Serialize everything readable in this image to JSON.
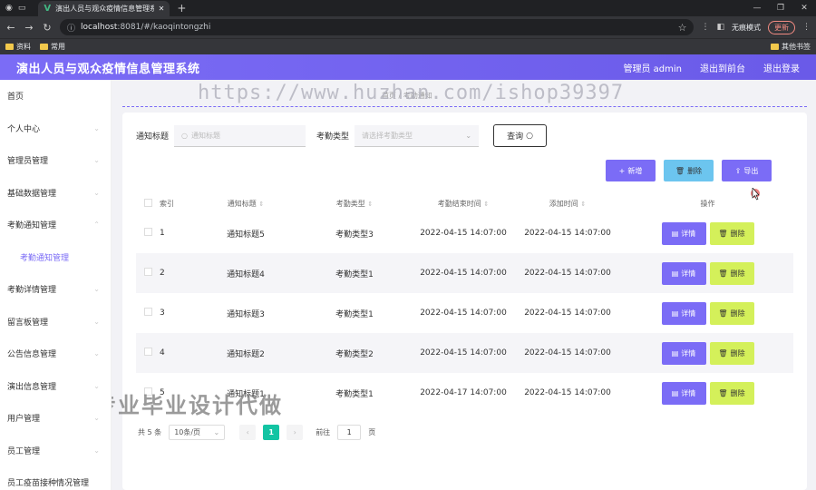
{
  "browser": {
    "tab_title": "演出人员与观众疫情信息管理系统",
    "url_host": "localhost",
    "url_rest": ":8081/#/kaoqintongzhi",
    "incognito_label": "无痕模式",
    "update_label": "更新",
    "bookmarks": [
      "资料",
      "常用"
    ],
    "bookmarks_right": "其他书签"
  },
  "header": {
    "title": "演出人员与观众疫情信息管理系统",
    "user": "管理员 admin",
    "back": "退出到前台",
    "logout": "退出登录"
  },
  "sidebar": {
    "items": [
      {
        "label": "首页"
      },
      {
        "label": "个人中心"
      },
      {
        "label": "管理员管理"
      },
      {
        "label": "基础数据管理"
      },
      {
        "label": "考勤通知管理"
      },
      {
        "label": "考勤通知管理"
      },
      {
        "label": "考勤详情管理"
      },
      {
        "label": "留言板管理"
      },
      {
        "label": "公告信息管理"
      },
      {
        "label": "演出信息管理"
      },
      {
        "label": "用户管理"
      },
      {
        "label": "员工管理"
      },
      {
        "label": "员工疫苗接种情况管理"
      }
    ]
  },
  "watermarks": {
    "url": "https://www.huzhan.com/ishop39397",
    "text": "专业毕业设计代做"
  },
  "breadcrumb": "首页 / 考勤通知",
  "search": {
    "title_label": "通知标题",
    "title_placeholder": "通知标题",
    "type_label": "考勤类型",
    "type_placeholder": "请选择考勤类型",
    "query_label": "查询"
  },
  "actions": {
    "add": "新增",
    "delete": "删除",
    "export": "导出"
  },
  "table": {
    "headers": [
      "索引",
      "通知标题",
      "考勤类型",
      "考勤结束时间",
      "添加时间",
      "操作"
    ],
    "rows": [
      {
        "idx": "1",
        "title": "通知标题5",
        "type": "考勤类型3",
        "end": "2022-04-15 14:07:00",
        "added": "2022-04-15 14:07:00"
      },
      {
        "idx": "2",
        "title": "通知标题4",
        "type": "考勤类型1",
        "end": "2022-04-15 14:07:00",
        "added": "2022-04-15 14:07:00"
      },
      {
        "idx": "3",
        "title": "通知标题3",
        "type": "考勤类型1",
        "end": "2022-04-15 14:07:00",
        "added": "2022-04-15 14:07:00"
      },
      {
        "idx": "4",
        "title": "通知标题2",
        "type": "考勤类型2",
        "end": "2022-04-15 14:07:00",
        "added": "2022-04-15 14:07:00"
      },
      {
        "idx": "5",
        "title": "通知标题1",
        "type": "考勤类型1",
        "end": "2022-04-17 14:07:00",
        "added": "2022-04-15 14:07:00"
      }
    ],
    "detail_label": "详情",
    "delete_label": "删除"
  },
  "pager": {
    "total": "共 5 条",
    "page_size": "10条/页",
    "prev": "‹",
    "current": "1",
    "next": "›",
    "goto_label": "前往",
    "goto_value": "1",
    "page_unit": "页"
  }
}
